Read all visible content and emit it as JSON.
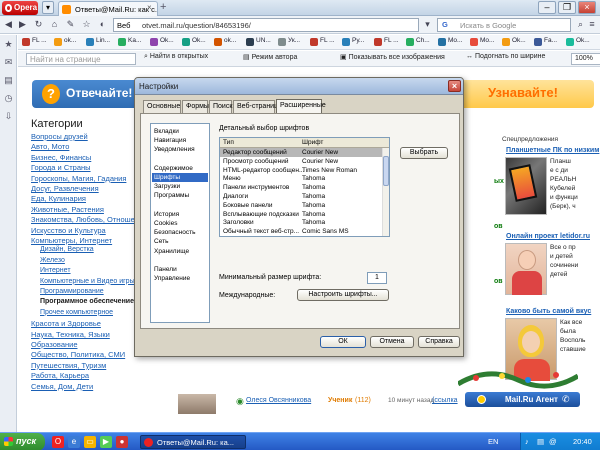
{
  "browser": {
    "opera_label": "Opera",
    "tabs": [
      {
        "label": "Ответы@Mail.Ru: как с..."
      }
    ],
    "address": {
      "prefix": "Веб",
      "url": "otvet.mail.ru/question/84653196/"
    },
    "search_placeholder": "Искать в Google",
    "bookmarks": [
      {
        "label": "FL ...",
        "color": "#c0392b"
      },
      {
        "label": "ok...",
        "color": "#f39c12"
      },
      {
        "label": "Lin...",
        "color": "#2980b9"
      },
      {
        "label": "Ka...",
        "color": "#27ae60"
      },
      {
        "label": "Ok...",
        "color": "#8e44ad"
      },
      {
        "label": "Ok...",
        "color": "#16a085"
      },
      {
        "label": "ok...",
        "color": "#d35400"
      },
      {
        "label": "UN...",
        "color": "#2c3e50"
      },
      {
        "label": "Ук...",
        "color": "#7f8c8d"
      },
      {
        "label": "FL ...",
        "color": "#c0392b"
      },
      {
        "label": "Ру...",
        "color": "#2980b9"
      },
      {
        "label": "FL ...",
        "color": "#c0392b"
      },
      {
        "label": "Ch...",
        "color": "#27ae60"
      },
      {
        "label": "Mo...",
        "color": "#2471a3"
      },
      {
        "label": "Mo...",
        "color": "#e74c3c"
      },
      {
        "label": "Ok...",
        "color": "#f39c12"
      },
      {
        "label": "Fa...",
        "color": "#3b5998"
      },
      {
        "label": "Ok...",
        "color": "#1abc9c"
      }
    ],
    "findbar": {
      "find_placeholder": "Найти на странице",
      "find_in_open": "Найти в открытых",
      "author_mode": "Режим автора",
      "show_images": "Показывать все изображения",
      "fit_width": "Подогнать по ширине",
      "zoom": "100%"
    }
  },
  "page": {
    "banner_left": "Отвечайте!",
    "banner_right": "Узнавайте!",
    "categories_title": "Категории",
    "categories": [
      "Вопросы друзей",
      "Авто, Мото",
      "Бизнес, Финансы",
      "Города и Страны",
      "Гороскопы, Магия, Гадания",
      "Досуг, Развлечения",
      "Еда, Кулинария",
      "Животные, Растения",
      "Знакомства, Любовь, Отношения",
      "Искусство и Культура",
      "Компьютеры, Интернет"
    ],
    "subcategories": [
      {
        "label": "Дизайн, Верстка",
        "bold": false
      },
      {
        "label": "Железо",
        "bold": false
      },
      {
        "label": "Интернет",
        "bold": false
      },
      {
        "label": "Компьютерные и Видео игры",
        "bold": false
      },
      {
        "label": "Программирование",
        "bold": false
      },
      {
        "label": "Программное обеспечение",
        "bold": true
      },
      {
        "label": "Прочее компьютерное",
        "bold": false
      }
    ],
    "categories_after": [
      "Красота и Здоровье",
      "Наука, Техника, Языки",
      "Образование",
      "Общество, Политика, СМИ",
      "Путешествия, Туризм",
      "Работа, Карьера",
      "Семья, Дом, Дети"
    ],
    "peek_texts": [
      "ых",
      "ов",
      "ов"
    ],
    "right": {
      "special_head": "Спецпредложения",
      "ad1": {
        "title": "Планшетные ПК по низким",
        "lines": [
          "Планш",
          "е с ди",
          "РЕАЛЬН",
          "Кубелей",
          "и функци",
          "(Берк), ч"
        ]
      },
      "ad2": {
        "title": "Онлайн проект letidor.ru",
        "lines": [
          "Все о пр",
          "и детей",
          "сочинени",
          "детей"
        ]
      },
      "ad3": {
        "title": "Каково быть самой вкус",
        "lines": [
          "Как все",
          "была",
          "Восполь",
          "ставшие"
        ]
      }
    },
    "bottom": {
      "user_name": "Олеся Овсянникова",
      "role": "Ученик",
      "score": "(112)",
      "time": "10 минут назад",
      "link": "(ссылка"
    },
    "agent_label": "Mail.Ru Агент"
  },
  "dialog": {
    "title": "Настройки",
    "tabs": [
      "Основные",
      "Формы",
      "Поиск",
      "Веб-страницы",
      "Расширенные"
    ],
    "active_tab": "Расширенные",
    "nav_items": [
      {
        "label": "Вкладки",
        "selected": false
      },
      {
        "label": "Навигация",
        "selected": false
      },
      {
        "label": "Уведомления",
        "selected": false
      },
      {
        "label": "",
        "selected": false
      },
      {
        "label": "Содержимое",
        "selected": false
      },
      {
        "label": "Шрифты",
        "selected": true
      },
      {
        "label": "Загрузки",
        "selected": false
      },
      {
        "label": "Программы",
        "selected": false
      },
      {
        "label": "",
        "selected": false
      },
      {
        "label": "История",
        "selected": false
      },
      {
        "label": "Cookies",
        "selected": false
      },
      {
        "label": "Безопасность",
        "selected": false
      },
      {
        "label": "Сеть",
        "selected": false
      },
      {
        "label": "Хранилище",
        "selected": false
      },
      {
        "label": "",
        "selected": false
      },
      {
        "label": "Панели",
        "selected": false
      },
      {
        "label": "Управление",
        "selected": false
      }
    ],
    "section_title": "Детальный выбор шрифтов",
    "columns": [
      "Тип",
      "Шрифт"
    ],
    "rows": [
      [
        "Редактор сообщений",
        "Courier New"
      ],
      [
        "Просмотр сообщений",
        "Courier New"
      ],
      [
        "HTML-редактор сообщен...",
        "Times New Roman"
      ],
      [
        "Меню",
        "Tahoma"
      ],
      [
        "Панели инструментов",
        "Tahoma"
      ],
      [
        "Диалоги",
        "Tahoma"
      ],
      [
        "Боковые панели",
        "Tahoma"
      ],
      [
        "Всплывающие подсказки",
        "Tahoma"
      ],
      [
        "Заголовки",
        "Tahoma"
      ],
      [
        "Обычный текст веб-стр...",
        "Comic Sans MS"
      ]
    ],
    "selected_row": 0,
    "choose_button": "Выбрать",
    "min_size_label": "Минимальный размер шрифта:",
    "min_size_value": "1",
    "intl_label": "Международные:",
    "intl_button": "Настроить шрифты...",
    "ok": "ОК",
    "cancel": "Отмена",
    "help": "Справка"
  },
  "taskbar": {
    "start": "пуск",
    "task_label": "Ответы@Mail.Ru: ка...",
    "lang": "EN",
    "clock": "20:40"
  }
}
